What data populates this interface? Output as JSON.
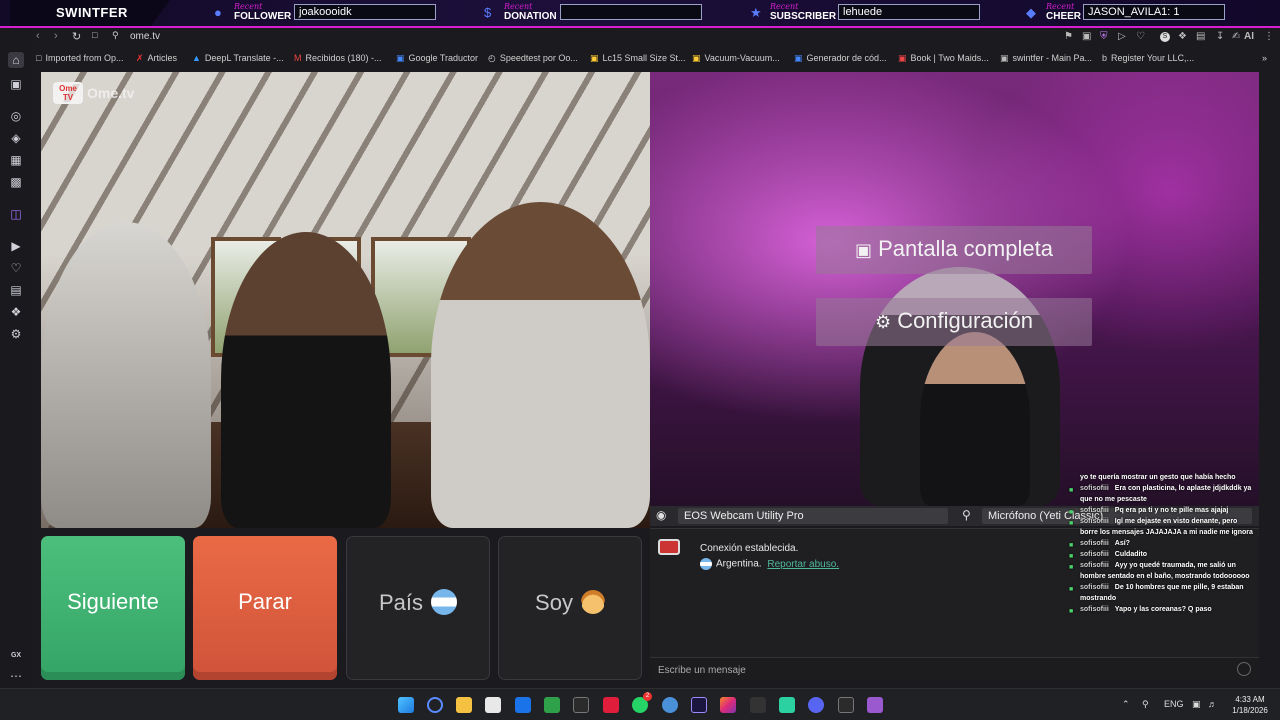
{
  "overlay": {
    "brand": "SWINTFER",
    "groups": [
      {
        "recent": "Recent",
        "label": "FOLLOWER",
        "value": "joakoooidk",
        "icon": "person-icon"
      },
      {
        "recent": "Recent",
        "label": "DONATION",
        "value": "",
        "icon": "dollar-icon"
      },
      {
        "recent": "Recent",
        "label": "SUBSCRIBER",
        "value": "lehuede",
        "icon": "star-icon"
      },
      {
        "recent": "Recent",
        "label": "CHEER",
        "value": "JASON_AVILA1: 1",
        "icon": "diamond-icon"
      }
    ]
  },
  "browser": {
    "url": "ome.tv",
    "bookmarks": [
      "Imported from Op...",
      "Articles",
      "DeepL Translate -...",
      "Recibidos (180) -...",
      "Google Traductor",
      "Speedtest por Oo...",
      "Lc15 Small Size St...",
      "Vacuum-Vacuum...",
      "Generador de cód...",
      "Book | Two Maids...",
      "swintfer - Main Pa...",
      "Register Your LLC,..."
    ],
    "sidebar_label": "GX",
    "ai_label": "AI"
  },
  "video": {
    "watermark": "Ome.tv",
    "logo_text": "Ome TV",
    "fullscreen_label": "Pantalla completa",
    "settings_label": "Configuración"
  },
  "devices": {
    "camera": "EOS Webcam Utility Pro",
    "microphone": "Micrófono (Yeti Classic)"
  },
  "controls": {
    "next": "Siguiente",
    "stop": "Parar",
    "country": "País",
    "gender": "Soy"
  },
  "chat": {
    "status": "Conexión establecida.",
    "country": "Argentina.",
    "report": "Reportar abuso.",
    "input_placeholder": "Escribe un mensaje"
  },
  "stream_chat": [
    {
      "user": "",
      "text": "yo te quería mostrar un gesto que había hecho"
    },
    {
      "user": "sofisofiii",
      "text": "Era con plasticina, lo aplaste jdjdkddk ya que no me pescaste"
    },
    {
      "user": "sofisofiii",
      "text": "Pq era pa ti y no te pille mas ajajaj"
    },
    {
      "user": "sofisofiii",
      "text": "Igl me dejaste en visto denante, pero borre los mensajes JAJAJAJA a mi nadie me ignora"
    },
    {
      "user": "sofisofiii",
      "text": "Así?"
    },
    {
      "user": "sofisofiii",
      "text": "Culdadito"
    },
    {
      "user": "sofisofiii",
      "text": "Ayy yo quedé traumada, me salió un hombre sentado en el baño, mostrando todoooooo"
    },
    {
      "user": "sofisofiii",
      "text": "De 10 hombres que me pille, 9 estaban mostrando"
    },
    {
      "user": "sofisofiii",
      "text": "Yapo y las coreanas? Q paso"
    }
  ],
  "taskbar": {
    "lang": "ENG",
    "time": "4:33 AM",
    "date": "1/18/2026",
    "badge": "2"
  }
}
